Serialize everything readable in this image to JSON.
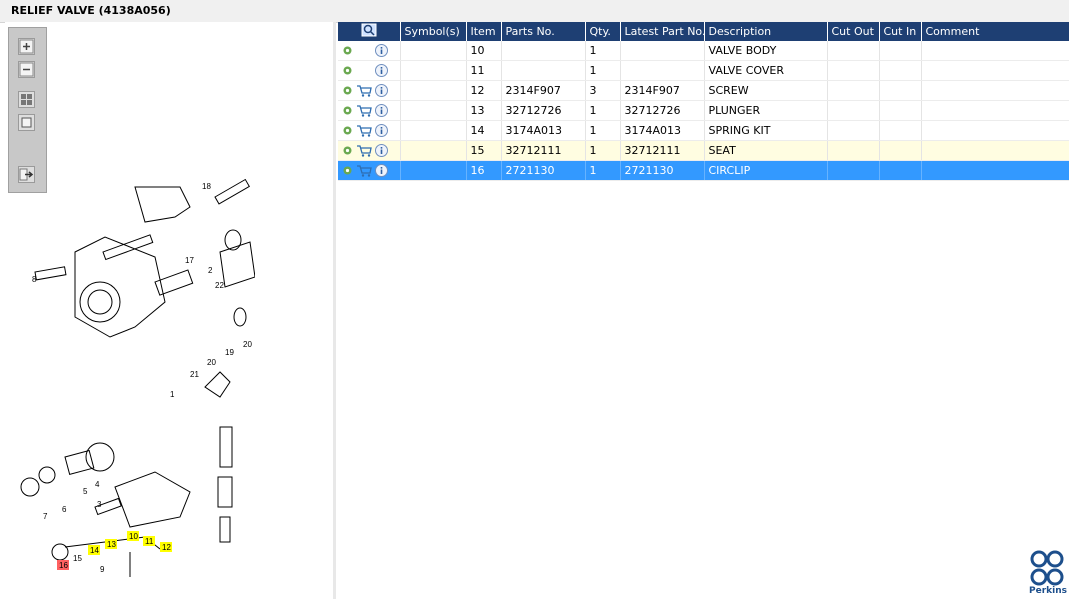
{
  "window": {
    "title": "RELIEF VALVE (4138A056)"
  },
  "toolbar": {
    "buttons": [
      {
        "name": "zoom-in",
        "icon": "zoom-in-icon"
      },
      {
        "name": "zoom-out",
        "icon": "zoom-out-icon"
      },
      {
        "name": "fit-all",
        "icon": "fit-grid-icon"
      },
      {
        "name": "actual-size",
        "icon": "square-icon"
      },
      {
        "name": "export",
        "icon": "export-arrow-icon"
      }
    ]
  },
  "diagram": {
    "callouts": [
      "18",
      "17",
      "2",
      "8",
      "22",
      "20",
      "19",
      "20",
      "21",
      "1",
      "3",
      "4",
      "5",
      "6",
      "7",
      "9",
      "10",
      "11",
      "12",
      "13",
      "14",
      "15",
      "16"
    ]
  },
  "grid": {
    "columns": [
      "",
      "Symbol(s)",
      "Item",
      "Parts No.",
      "Qty.",
      "Latest Part No.",
      "Description",
      "Cut Out",
      "Cut In",
      "Comment"
    ],
    "rows": [
      {
        "cart": false,
        "item": "10",
        "parts_no": "",
        "qty": "1",
        "latest": "",
        "desc": "VALVE BODY",
        "state": "normal"
      },
      {
        "cart": false,
        "item": "11",
        "parts_no": "",
        "qty": "1",
        "latest": "",
        "desc": "VALVE COVER",
        "state": "normal"
      },
      {
        "cart": true,
        "item": "12",
        "parts_no": "2314F907",
        "qty": "3",
        "latest": "2314F907",
        "desc": "SCREW",
        "state": "normal"
      },
      {
        "cart": true,
        "item": "13",
        "parts_no": "32712726",
        "qty": "1",
        "latest": "32712726",
        "desc": "PLUNGER",
        "state": "normal"
      },
      {
        "cart": true,
        "item": "14",
        "parts_no": "3174A013",
        "qty": "1",
        "latest": "3174A013",
        "desc": "SPRING KIT",
        "state": "normal"
      },
      {
        "cart": true,
        "item": "15",
        "parts_no": "32712111",
        "qty": "1",
        "latest": "32712111",
        "desc": "SEAT",
        "state": "highlight"
      },
      {
        "cart": true,
        "item": "16",
        "parts_no": "2721130",
        "qty": "1",
        "latest": "2721130",
        "desc": "CIRCLIP",
        "state": "selected"
      }
    ]
  },
  "brand": {
    "name": "Perkins",
    "color": "#1d4f8c"
  },
  "colors": {
    "header": "#1e3f73",
    "selected": "#3399ff",
    "highlight": "#fffde1",
    "callout_yellow": "#ffff00",
    "callout_red": "#ff6060"
  }
}
